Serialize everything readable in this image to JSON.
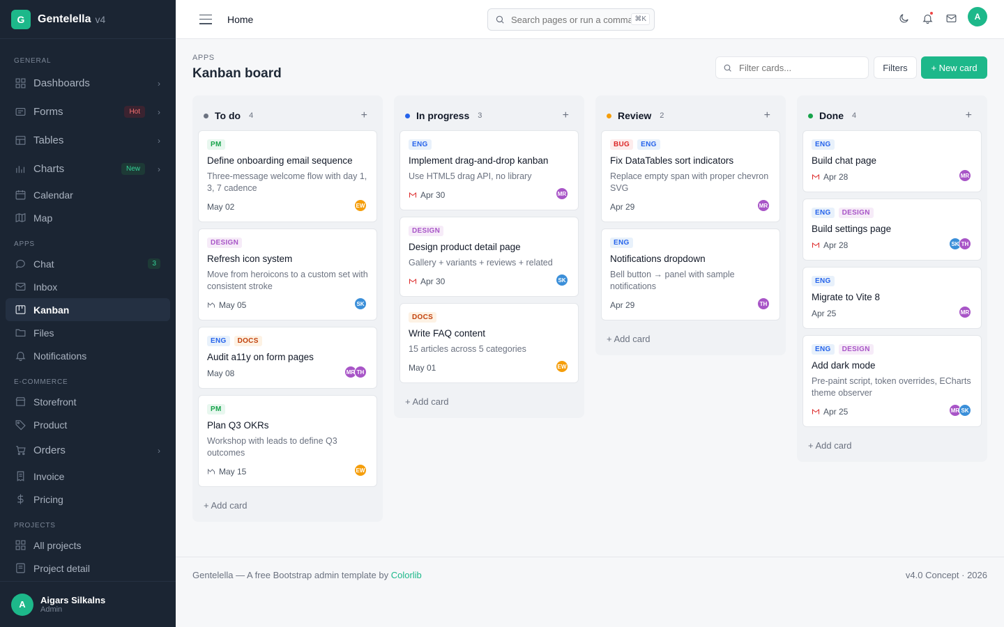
{
  "brand": {
    "logo_letter": "G",
    "name": "Gentelella",
    "version": "v4"
  },
  "sidebar": {
    "sections": {
      "general": "GENERAL",
      "apps": "APPS",
      "ecommerce": "E-COMMERCE",
      "projects": "PROJECTS"
    },
    "items": {
      "dashboards": "Dashboards",
      "forms": "Forms",
      "forms_badge": "Hot",
      "tables": "Tables",
      "charts": "Charts",
      "charts_badge": "New",
      "calendar": "Calendar",
      "map": "Map",
      "chat": "Chat",
      "chat_count": "3",
      "inbox": "Inbox",
      "kanban": "Kanban",
      "files": "Files",
      "notifications": "Notifications",
      "storefront": "Storefront",
      "product": "Product",
      "orders": "Orders",
      "invoice": "Invoice",
      "pricing": "Pricing",
      "all_projects": "All projects",
      "project_detail": "Project detail"
    },
    "user": {
      "initial": "A",
      "name": "Aigars Silkalns",
      "role": "Admin"
    }
  },
  "topbar": {
    "breadcrumb": "Home",
    "search_placeholder": "Search pages or run a command",
    "search_shortcut": "⌘K",
    "avatar_initial": "A"
  },
  "page": {
    "kicker": "APPS",
    "title": "Kanban board",
    "filter_placeholder": "Filter cards...",
    "filters_label": "Filters",
    "new_card_label": "+ New card",
    "add_card_label": "+ Add card"
  },
  "columns": [
    {
      "title": "To do",
      "count": "4",
      "dot_color": "#6b7280",
      "cards": [
        {
          "tags": [
            "PM"
          ],
          "title": "Define onboarding email sequence",
          "desc": "Three-message welcome flow with day 1, 3, 7 cadence",
          "date": "May 02",
          "icon": "",
          "avatars": [
            {
              "i": "EW",
              "c": "#f59e0b"
            }
          ]
        },
        {
          "tags": [
            "DESIGN"
          ],
          "title": "Refresh icon system",
          "desc": "Move from heroicons to a custom set with consistent stroke",
          "date": "May 05",
          "icon": "figma-icon",
          "avatars": [
            {
              "i": "SK",
              "c": "#3b8fd9"
            }
          ]
        },
        {
          "tags": [
            "ENG",
            "DOCS"
          ],
          "title": "Audit a11y on form pages",
          "desc": "",
          "date": "May 08",
          "icon": "",
          "avatars": [
            {
              "i": "MR",
              "c": "#a855c7"
            },
            {
              "i": "TH",
              "c": "#a855c7"
            }
          ]
        },
        {
          "tags": [
            "PM"
          ],
          "title": "Plan Q3 OKRs",
          "desc": "Workshop with leads to define Q3 outcomes",
          "date": "May 15",
          "icon": "figma-icon",
          "avatars": [
            {
              "i": "EW",
              "c": "#f59e0b"
            }
          ]
        }
      ]
    },
    {
      "title": "In progress",
      "count": "3",
      "dot_color": "#2563eb",
      "cards": [
        {
          "tags": [
            "ENG"
          ],
          "title": "Implement drag-and-drop kanban",
          "desc": "Use HTML5 drag API, no library",
          "date": "Apr 30",
          "icon": "gmail-icon",
          "avatars": [
            {
              "i": "MR",
              "c": "#a855c7"
            }
          ]
        },
        {
          "tags": [
            "DESIGN"
          ],
          "title": "Design product detail page",
          "desc": "Gallery + variants + reviews + related",
          "date": "Apr 30",
          "icon": "gmail-icon",
          "avatars": [
            {
              "i": "SK",
              "c": "#3b8fd9"
            }
          ]
        },
        {
          "tags": [
            "DOCS"
          ],
          "title": "Write FAQ content",
          "desc": "15 articles across 5 categories",
          "date": "May 01",
          "icon": "",
          "avatars": [
            {
              "i": "EW",
              "c": "#f59e0b"
            }
          ]
        }
      ]
    },
    {
      "title": "Review",
      "count": "2",
      "dot_color": "#f59e0b",
      "cards": [
        {
          "tags": [
            "BUG",
            "ENG"
          ],
          "title": "Fix DataTables sort indicators",
          "desc": "Replace empty span with proper chevron SVG",
          "date": "Apr 29",
          "icon": "",
          "avatars": [
            {
              "i": "MR",
              "c": "#a855c7"
            }
          ]
        },
        {
          "tags": [
            "ENG"
          ],
          "title": "Notifications dropdown",
          "desc": "Bell button → panel with sample notifications",
          "date": "Apr 29",
          "icon": "",
          "avatars": [
            {
              "i": "TH",
              "c": "#a855c7"
            }
          ]
        }
      ]
    },
    {
      "title": "Done",
      "count": "4",
      "dot_color": "#16a34a",
      "cards": [
        {
          "tags": [
            "ENG"
          ],
          "title": "Build chat page",
          "desc": "",
          "date": "Apr 28",
          "icon": "gmail-icon",
          "avatars": [
            {
              "i": "MR",
              "c": "#a855c7"
            }
          ]
        },
        {
          "tags": [
            "ENG",
            "DESIGN"
          ],
          "title": "Build settings page",
          "desc": "",
          "date": "Apr 28",
          "icon": "gmail-icon",
          "avatars": [
            {
              "i": "SK",
              "c": "#3b8fd9"
            },
            {
              "i": "TH",
              "c": "#a855c7"
            }
          ]
        },
        {
          "tags": [
            "ENG"
          ],
          "title": "Migrate to Vite 8",
          "desc": "",
          "date": "Apr 25",
          "icon": "",
          "avatars": [
            {
              "i": "MR",
              "c": "#a855c7"
            }
          ]
        },
        {
          "tags": [
            "ENG",
            "DESIGN"
          ],
          "title": "Add dark mode",
          "desc": "Pre-paint script, token overrides, ECharts theme observer",
          "date": "Apr 25",
          "icon": "gmail-icon",
          "avatars": [
            {
              "i": "MR",
              "c": "#a855c7"
            },
            {
              "i": "SK",
              "c": "#3b8fd9"
            }
          ]
        }
      ]
    }
  ],
  "footer": {
    "left_text": "Gentelella — A free Bootstrap admin template by ",
    "left_link": "Colorlib",
    "right_text": "v4.0 Concept · 2026"
  }
}
